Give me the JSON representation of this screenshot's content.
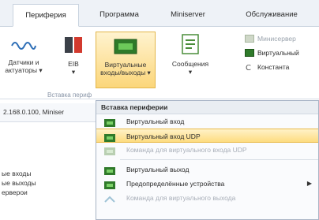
{
  "tabs": [
    {
      "label": "Периферия",
      "active": true
    },
    {
      "label": "Программа",
      "active": false
    },
    {
      "label": "Miniserver",
      "active": false
    },
    {
      "label": "Обслуживание",
      "active": false
    }
  ],
  "ribbon": {
    "sensors_label": "Датчики и\nактуаторы ▾",
    "eib_label": "EIB\n▾",
    "virtual_io_label": "Виртуальные\nвходы/выходы ▾",
    "messages_label": "Сообщения\n▾",
    "memory_flags_label": "Минисервер",
    "virtual_small_label": "Виртуальный",
    "constant_label": "Константа",
    "group_label": "Вставка периф"
  },
  "address": "2.168.0.100, Miniser",
  "left_list": [
    "ые входы",
    "ые выходы",
    "ерверои"
  ],
  "menu": {
    "header": "Вставка периферии",
    "items": [
      {
        "label": "Виртуальный вход",
        "state": "normal"
      },
      {
        "label": "Виртуальный вход UDP",
        "state": "highlight"
      },
      {
        "label": "Команда для виртуального входа UDP",
        "state": "disabled"
      },
      {
        "label": "Виртуальный выход",
        "state": "normal"
      },
      {
        "label": "Предопределённые устройства",
        "state": "submenu"
      },
      {
        "label": "Команда для виртуального выхода",
        "state": "disabled"
      }
    ]
  },
  "colors": {
    "accent": "#fbd67a",
    "icon_green": "#3f9b2f",
    "icon_red": "#c43a2f",
    "icon_blue": "#3a78c2"
  }
}
